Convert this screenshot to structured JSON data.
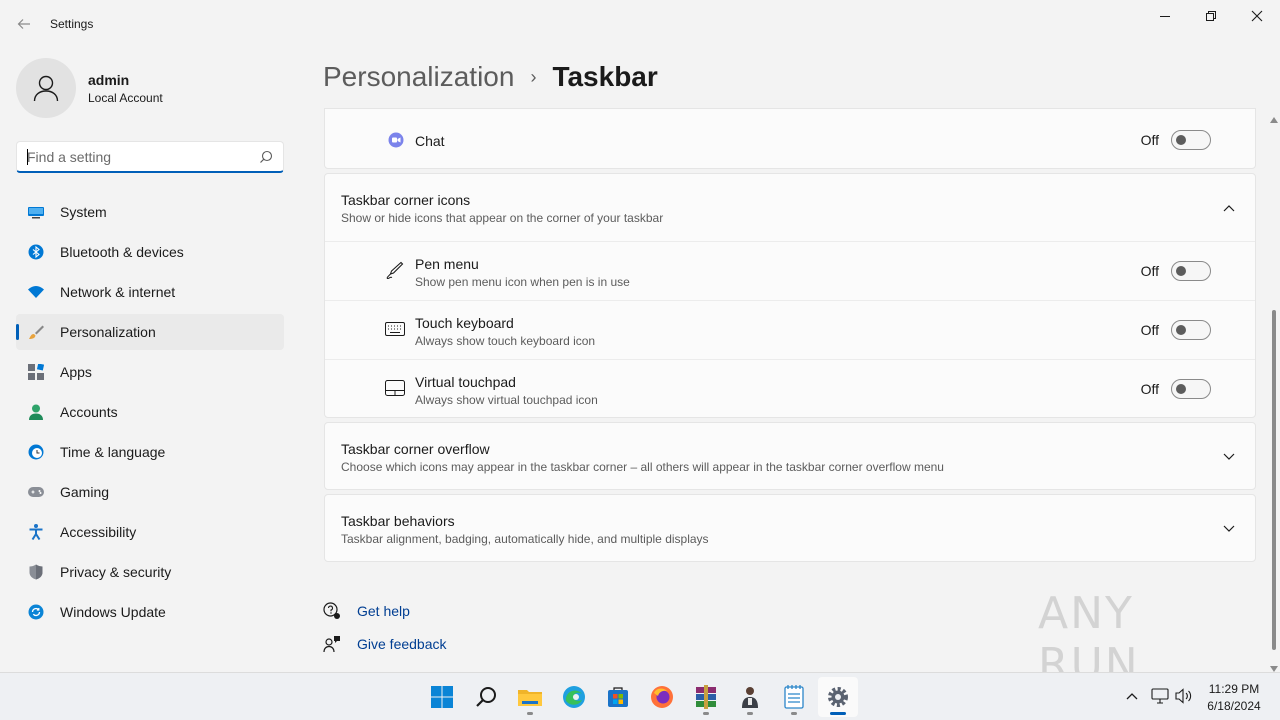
{
  "window": {
    "title": "Settings"
  },
  "user": {
    "name": "admin",
    "account_type": "Local Account"
  },
  "search": {
    "placeholder": "Find a setting"
  },
  "nav": {
    "items": [
      {
        "label": "System",
        "icon": "monitor-icon"
      },
      {
        "label": "Bluetooth & devices",
        "icon": "bluetooth-icon"
      },
      {
        "label": "Network & internet",
        "icon": "wifi-icon"
      },
      {
        "label": "Personalization",
        "icon": "paintbrush-icon",
        "active": true
      },
      {
        "label": "Apps",
        "icon": "apps-icon"
      },
      {
        "label": "Accounts",
        "icon": "person-icon"
      },
      {
        "label": "Time & language",
        "icon": "clock-globe-icon"
      },
      {
        "label": "Gaming",
        "icon": "gamepad-icon"
      },
      {
        "label": "Accessibility",
        "icon": "accessibility-icon"
      },
      {
        "label": "Privacy & security",
        "icon": "shield-icon"
      },
      {
        "label": "Windows Update",
        "icon": "update-icon"
      }
    ]
  },
  "breadcrumb": {
    "parent": "Personalization",
    "separator": "›",
    "current": "Taskbar"
  },
  "chat": {
    "label": "Chat",
    "state": "Off"
  },
  "corner_icons": {
    "title": "Taskbar corner icons",
    "subtitle": "Show or hide icons that appear on the corner of your taskbar",
    "items": [
      {
        "title": "Pen menu",
        "subtitle": "Show pen menu icon when pen is in use",
        "state": "Off"
      },
      {
        "title": "Touch keyboard",
        "subtitle": "Always show touch keyboard icon",
        "state": "Off"
      },
      {
        "title": "Virtual touchpad",
        "subtitle": "Always show virtual touchpad icon",
        "state": "Off"
      }
    ]
  },
  "corner_overflow": {
    "title": "Taskbar corner overflow",
    "subtitle": "Choose which icons may appear in the taskbar corner – all others will appear in the taskbar corner overflow menu"
  },
  "behaviors": {
    "title": "Taskbar behaviors",
    "subtitle": "Taskbar alignment, badging, automatically hide, and multiple displays"
  },
  "help": {
    "get_help": "Get help",
    "give_feedback": "Give feedback"
  },
  "watermark": {
    "text": "ANY RUN"
  },
  "taskbar": {
    "apps": [
      "start-icon",
      "search-icon",
      "file-explorer-icon",
      "edge-icon",
      "store-icon",
      "firefox-icon",
      "winrar-icon",
      "user-app-icon",
      "notepad-icon",
      "settings-icon"
    ],
    "time": "11:29 PM",
    "date": "6/18/2024"
  },
  "colors": {
    "accent": "#005fb8",
    "link": "#003e92"
  }
}
